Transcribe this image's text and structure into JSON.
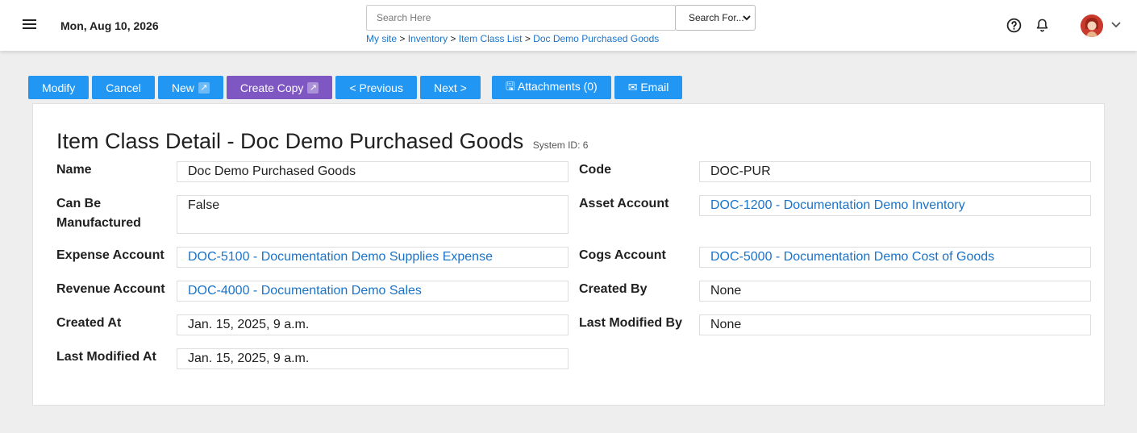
{
  "header": {
    "date": "Mon, Aug 10, 2026",
    "search_placeholder": "Search Here",
    "search_select": "Search For...",
    "breadcrumb": [
      {
        "label": "My site",
        "sep": ">"
      },
      {
        "label": "Inventory",
        "sep": ">"
      },
      {
        "label": "Item Class List",
        "sep": ">"
      },
      {
        "label": "Doc Demo Purchased Goods",
        "sep": ""
      }
    ],
    "icons": {
      "menu": "hamburger-icon",
      "help": "help-circle-icon",
      "notifications": "bell-icon",
      "account": "chevron-down-icon"
    }
  },
  "toolbar": {
    "modify": "Modify",
    "cancel": "Cancel",
    "new": "New",
    "create_copy": "Create Copy",
    "previous": "< Previous",
    "next": "Next >",
    "attachments": "🖫 Attachments (0)",
    "email": "✉ Email",
    "ext_glyph": "↗"
  },
  "detail": {
    "title": "Item Class Detail - Doc Demo Purchased Goods",
    "system_id": "System ID: 6",
    "fields": {
      "name": {
        "label": "Name",
        "value": "Doc Demo Purchased Goods"
      },
      "code": {
        "label": "Code",
        "value": "DOC-PUR"
      },
      "can_be_manufactured": {
        "label": "Can Be Manufactured",
        "value": "False"
      },
      "asset_account": {
        "label": "Asset Account",
        "value": "DOC-1200 - Documentation Demo Inventory"
      },
      "expense_account": {
        "label": "Expense Account",
        "value": "DOC-5100 - Documentation Demo Supplies Expense"
      },
      "cogs_account": {
        "label": "Cogs Account",
        "value": "DOC-5000 - Documentation Demo Cost of Goods"
      },
      "revenue_account": {
        "label": "Revenue Account",
        "value": "DOC-4000 - Documentation Demo Sales"
      },
      "created_by": {
        "label": "Created By",
        "value": "None"
      },
      "created_at": {
        "label": "Created At",
        "value": "Jan. 15, 2025, 9 a.m."
      },
      "last_modified_by": {
        "label": "Last Modified By",
        "value": "None"
      },
      "last_modified_at": {
        "label": "Last Modified At",
        "value": "Jan. 15, 2025, 9 a.m."
      }
    }
  },
  "colors": {
    "primary": "#2196f3",
    "secondary": "#7e57c2",
    "link": "#1a73c8",
    "background": "#eeeeee"
  }
}
